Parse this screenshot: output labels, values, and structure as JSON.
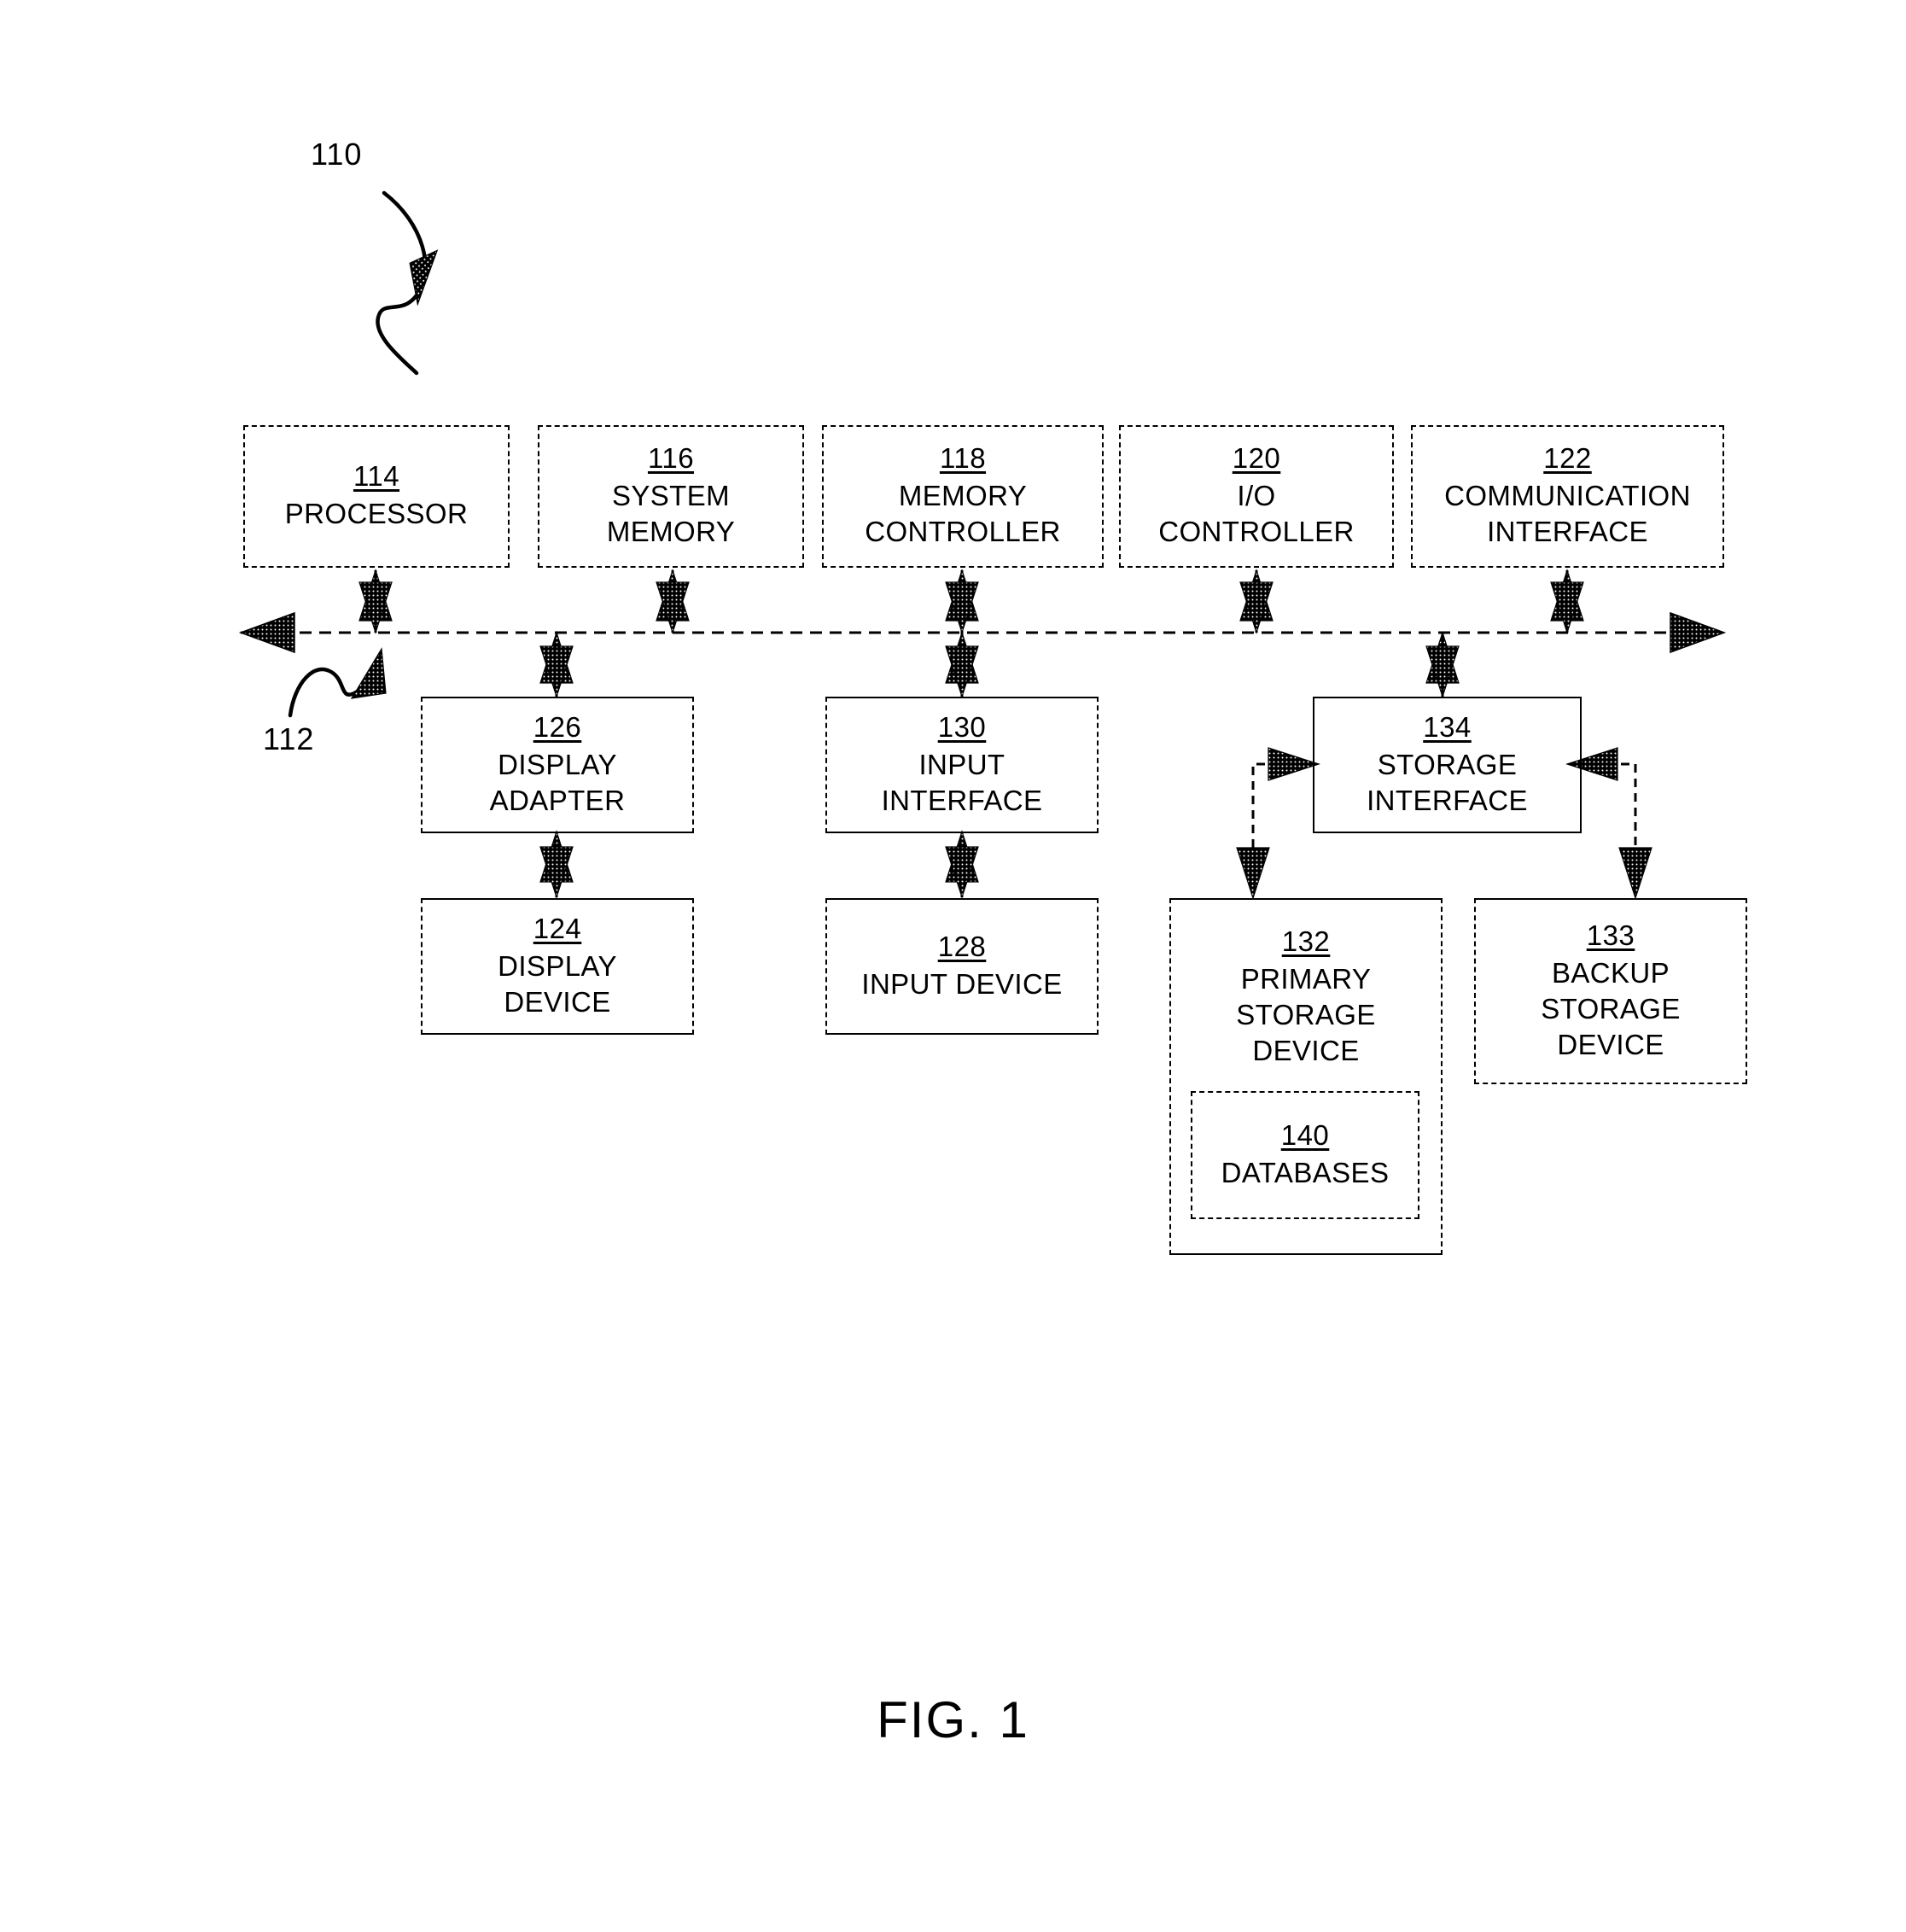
{
  "figure": {
    "caption": "FIG. 1",
    "callouts": [
      {
        "id": "system-callout",
        "text": "110"
      },
      {
        "id": "bus-callout",
        "text": "112"
      }
    ]
  },
  "nodes": [
    {
      "key": "processor",
      "ref": "114",
      "label": "PROCESSOR"
    },
    {
      "key": "system-memory",
      "ref": "116",
      "label": "SYSTEM\nMEMORY"
    },
    {
      "key": "memory-controller",
      "ref": "118",
      "label": "MEMORY\nCONTROLLER"
    },
    {
      "key": "io-controller",
      "ref": "120",
      "label": "I/O\nCONTROLLER"
    },
    {
      "key": "communication-interface",
      "ref": "122",
      "label": "COMMUNICATION\nINTERFACE"
    },
    {
      "key": "display-adapter",
      "ref": "126",
      "label": "DISPLAY\nADAPTER"
    },
    {
      "key": "input-interface",
      "ref": "130",
      "label": "INPUT\nINTERFACE"
    },
    {
      "key": "storage-interface",
      "ref": "134",
      "label": "STORAGE\nINTERFACE"
    },
    {
      "key": "display-device",
      "ref": "124",
      "label": "DISPLAY\nDEVICE"
    },
    {
      "key": "input-device",
      "ref": "128",
      "label": "INPUT DEVICE"
    },
    {
      "key": "primary-storage-device",
      "ref": "132",
      "label": "PRIMARY\nSTORAGE\nDEVICE"
    },
    {
      "key": "backup-storage-device",
      "ref": "133",
      "label": "BACKUP\nSTORAGE\nDEVICE"
    },
    {
      "key": "databases",
      "ref": "140",
      "label": "DATABASES"
    }
  ],
  "colors": {
    "line": "#000000",
    "background": "#ffffff"
  }
}
